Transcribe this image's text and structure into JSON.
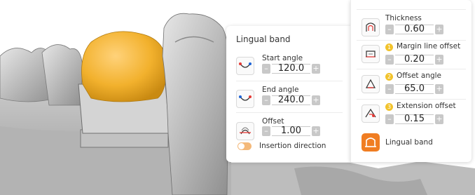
{
  "left_panel": {
    "title": "Lingual band",
    "items": [
      {
        "label": "Start angle",
        "value": "120.0",
        "icon": "start-angle-icon"
      },
      {
        "label": "End angle",
        "value": "240.0",
        "icon": "end-angle-icon"
      },
      {
        "label": "Offset",
        "value": "1.00",
        "icon": "offset-icon"
      }
    ],
    "toggle_label": "Insertion direction"
  },
  "right_panel": {
    "items": [
      {
        "label": "Thickness",
        "value": "0.60",
        "badge": ""
      },
      {
        "label": "Margin line offset",
        "value": "0.20",
        "badge": "1"
      },
      {
        "label": "Offset angle",
        "value": "65.0",
        "badge": "2"
      },
      {
        "label": "Extension offset",
        "value": "0.15",
        "badge": "3"
      }
    ],
    "action_label": "Lingual band"
  },
  "stepper": {
    "minus": "–",
    "plus": "+"
  },
  "colors": {
    "accent": "#f07d22",
    "crown": "#f2b12d",
    "model": "#c9c9c9",
    "badge": "#f2c32c"
  }
}
